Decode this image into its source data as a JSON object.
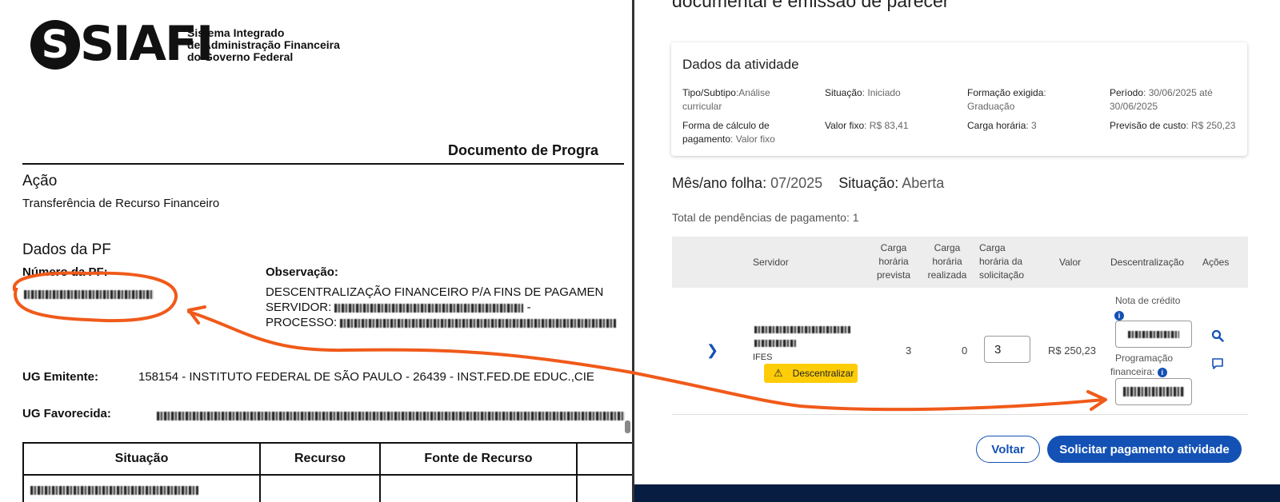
{
  "left": {
    "logo": {
      "word": "SIAFI",
      "desc": [
        "Sistema Integrado",
        "de Administração Financeira",
        "do Governo Federal"
      ]
    },
    "doc_title": "Documento de Progra",
    "acao": {
      "heading": "Ação",
      "value": "Transferência de Recurso Financeiro"
    },
    "dados_pf": {
      "heading": "Dados da PF",
      "numero_label": "Número da PF:",
      "observacao_label": "Observação:",
      "obs_line1": "DESCENTRALIZAÇÃO FINANCEIRO P/A FINS DE PAGAMEN",
      "obs_line2": "SERVIDOR:",
      "obs_line3": "PROCESSO:"
    },
    "ug_emitente": {
      "label": "UG Emitente:",
      "value": "158154 - INSTITUTO FEDERAL DE SÃO PAULO - 26439 - INST.FED.DE EDUC.,CIE"
    },
    "ug_favorecida": {
      "label": "UG Favorecida:"
    },
    "table_headers": [
      "Situação",
      "Recurso",
      "Fonte de Recurso"
    ]
  },
  "modal": {
    "title": "documental e emissão de parecer",
    "card": {
      "heading": "Dados da atividade",
      "tipo_label": "Tipo/Subtipo",
      "tipo_value": ":Análise curricular",
      "situacao_label": "Situação",
      "situacao_value": ": Iniciado",
      "formacao_label": "Formação exigida",
      "formacao_value": ": Graduação",
      "periodo_label": "Período",
      "periodo_value": ": 30/06/2025 até 30/06/2025",
      "forma_label": "Forma de cálculo de pagamento",
      "forma_value": ": Valor fixo",
      "valor_label": "Valor fixo",
      "valor_value": ": R$ 83,41",
      "carga_label": "Carga horária",
      "carga_value": ": 3",
      "previsao_label": "Previsão de custo",
      "previsao_value": ": R$ 250,23"
    },
    "folha": {
      "label": "Mês/ano folha:",
      "value": "07/2025",
      "sit_label": "Situação:",
      "sit_value": "Aberta"
    },
    "pendencias": "Total de pendências de pagamento: 1",
    "headers": {
      "servidor": "Servidor",
      "carga_prevista": [
        "Carga",
        "horária",
        "prevista"
      ],
      "carga_realizada": [
        "Carga",
        "horária",
        "realizada"
      ],
      "carga_solic": [
        "Carga",
        "horária da",
        "solicitação"
      ],
      "valor": "Valor",
      "descentralizacao": "Descentralização",
      "acoes": "Ações"
    },
    "row": {
      "ifes": "IFES",
      "badge": "Descentralizar",
      "prevista": "3",
      "realizada": "0",
      "solicitacao": "3",
      "valor": "R$ 250,23",
      "nota_label": "Nota de crédito",
      "prog_label_1": "Programação",
      "prog_label_2": "financeira:"
    },
    "buttons": {
      "back": "Voltar",
      "pay": "Solicitar pagamento atividade"
    }
  },
  "colors": {
    "primary": "#1351b4",
    "warning": "#ffcd07",
    "annotation": "#f05a1a",
    "footer": "#071d41"
  },
  "icons": [
    "chevron-right-icon",
    "warning-icon",
    "info-icon",
    "search-icon",
    "comment-icon"
  ]
}
